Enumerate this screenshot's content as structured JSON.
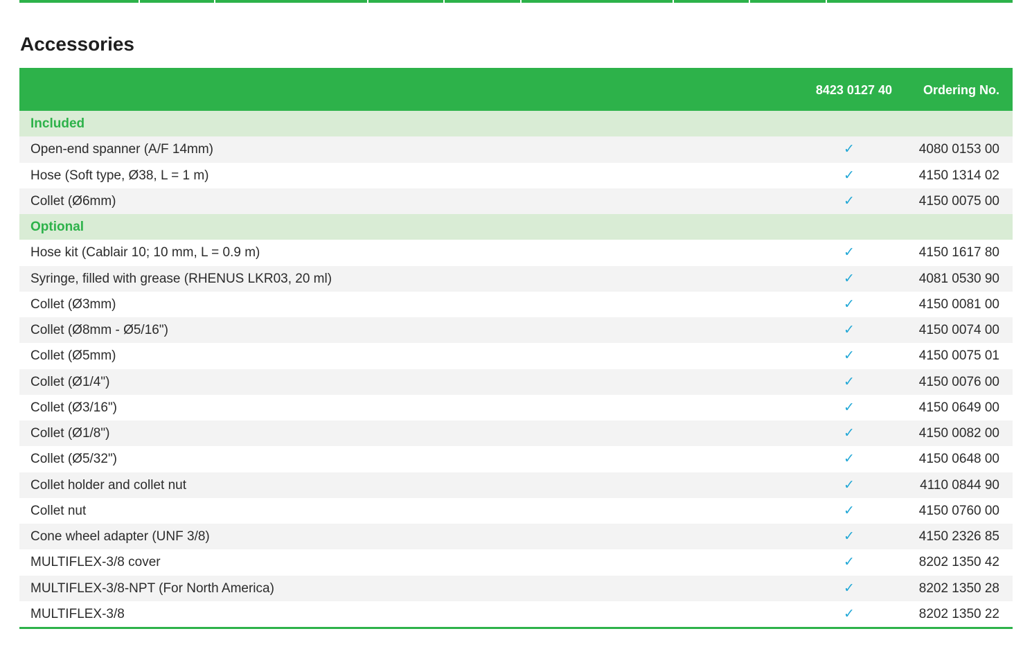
{
  "title": "Accessories",
  "table": {
    "header": {
      "model": "8423 0127 40",
      "ordering": "Ordering No."
    },
    "check_mark": "✓",
    "groups": [
      {
        "name": "Included",
        "items": [
          {
            "label": "Open-end spanner (A/F 14mm)",
            "order_no": "4080 0153 00"
          },
          {
            "label": "Hose (Soft type, Ø38, L = 1 m)",
            "order_no": "4150 1314 02"
          },
          {
            "label": "Collet (Ø6mm)",
            "order_no": "4150 0075 00"
          }
        ]
      },
      {
        "name": "Optional",
        "items": [
          {
            "label": "Hose kit (Cablair 10; 10 mm, L = 0.9 m)",
            "order_no": "4150 1617 80"
          },
          {
            "label": "Syringe, filled with grease (RHENUS LKR03, 20 ml)",
            "order_no": "4081 0530 90"
          },
          {
            "label": "Collet (Ø3mm)",
            "order_no": "4150 0081 00"
          },
          {
            "label": "Collet (Ø8mm - Ø5/16\")",
            "order_no": "4150 0074 00"
          },
          {
            "label": "Collet (Ø5mm)",
            "order_no": "4150 0075 01"
          },
          {
            "label": "Collet (Ø1/4\")",
            "order_no": "4150 0076 00"
          },
          {
            "label": "Collet (Ø3/16\")",
            "order_no": "4150 0649 00"
          },
          {
            "label": "Collet (Ø1/8\")",
            "order_no": "4150 0082 00"
          },
          {
            "label": "Collet (Ø5/32\")",
            "order_no": "4150 0648 00"
          },
          {
            "label": "Collet holder and collet nut",
            "order_no": "4110 0844 90"
          },
          {
            "label": "Collet nut",
            "order_no": "4150 0760 00"
          },
          {
            "label": "Cone wheel adapter (UNF 3/8)",
            "order_no": "4150 2326 85"
          },
          {
            "label": "MULTIFLEX-3/8 cover",
            "order_no": "8202 1350 42"
          },
          {
            "label": "MULTIFLEX-3/8-NPT (For North America)",
            "order_no": "8202 1350 28"
          },
          {
            "label": "MULTIFLEX-3/8",
            "order_no": "8202 1350 22"
          }
        ]
      }
    ]
  },
  "colors": {
    "accent": "#2db24a",
    "group_bg": "#d9ecd5",
    "check": "#20a7d6",
    "stripe": "#f3f3f3"
  }
}
